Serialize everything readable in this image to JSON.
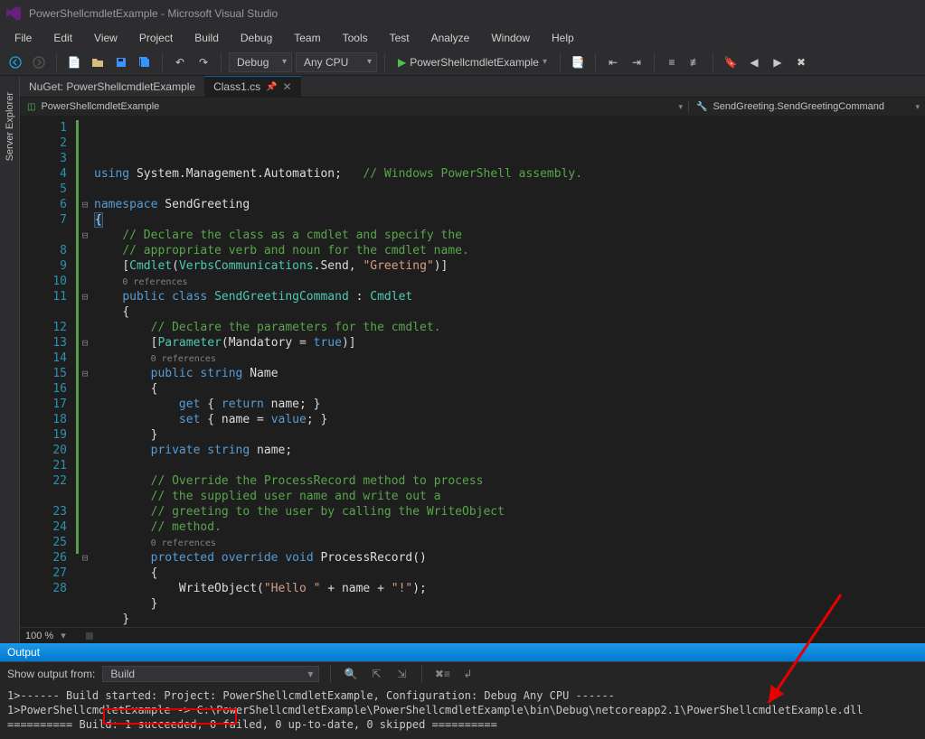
{
  "title": "PowerShellcmdletExample - Microsoft Visual Studio",
  "menu": [
    "File",
    "Edit",
    "View",
    "Project",
    "Build",
    "Debug",
    "Team",
    "Tools",
    "Test",
    "Analyze",
    "Window",
    "Help"
  ],
  "toolbar": {
    "config": "Debug",
    "platform": "Any CPU",
    "start_target": "PowerShellcmdletExample"
  },
  "side_tool": "Server Explorer",
  "tabs": [
    {
      "label": "NuGet: PowerShellcmdletExample",
      "active": false
    },
    {
      "label": "Class1.cs",
      "active": true,
      "pinned": true
    }
  ],
  "nav_left": "PowerShellcmdletExample",
  "nav_right": "SendGreeting.SendGreetingCommand",
  "zoom": "100 %",
  "code_lines": [
    {
      "n": 1,
      "html": "<span class='kw'>using</span> <span class='pl'>System.Management.Automation;</span>   <span class='cm'>// Windows PowerShell assembly.</span>"
    },
    {
      "n": 2,
      "html": ""
    },
    {
      "n": 3,
      "fold": "minus",
      "html": "<span class='kw'>namespace</span> <span class='pl'>SendGreeting</span>"
    },
    {
      "n": 4,
      "html": "<span class='brace-hi pl'>{</span>"
    },
    {
      "n": 5,
      "fold": "minus",
      "html": "    <span class='cm'>// Declare the class as a cmdlet and specify the</span>"
    },
    {
      "n": 6,
      "html": "    <span class='cm'>// appropriate verb and noun for the cmdlet name.</span>"
    },
    {
      "n": 7,
      "html": "    <span class='pl'>[</span><span class='ty'>Cmdlet</span><span class='pl'>(</span><span class='ty'>VerbsCommunications</span><span class='pl'>.Send, </span><span class='str'>\"Greeting\"</span><span class='pl'>)]</span>"
    },
    {
      "n": null,
      "html": "    <span class='ref'>0 references</span>"
    },
    {
      "n": 8,
      "fold": "minus",
      "html": "    <span class='kw'>public class</span> <span class='ty'>SendGreetingCommand</span> <span class='pl'>:</span> <span class='ty'>Cmdlet</span>"
    },
    {
      "n": 9,
      "html": "    <span class='pl'>{</span>"
    },
    {
      "n": 10,
      "html": "        <span class='cm'>// Declare the parameters for the cmdlet.</span>"
    },
    {
      "n": 11,
      "fold": "minus",
      "html": "        <span class='pl'>[</span><span class='ty'>Parameter</span><span class='pl'>(Mandatory = </span><span class='kw'>true</span><span class='pl'>)]</span>"
    },
    {
      "n": null,
      "html": "        <span class='ref'>0 references</span>"
    },
    {
      "n": 12,
      "fold": "minus",
      "html": "        <span class='kw'>public</span> <span class='kw'>string</span> <span class='pl'>Name</span>"
    },
    {
      "n": 13,
      "html": "        <span class='pl'>{</span>"
    },
    {
      "n": 14,
      "html": "            <span class='kw'>get</span> <span class='pl'>{ </span><span class='kw'>return</span><span class='pl'> name; }</span>"
    },
    {
      "n": 15,
      "html": "            <span class='kw'>set</span> <span class='pl'>{ name = </span><span class='kw'>value</span><span class='pl'>; }</span>"
    },
    {
      "n": 16,
      "html": "        <span class='pl'>}</span>"
    },
    {
      "n": 17,
      "html": "        <span class='kw'>private</span> <span class='kw'>string</span> <span class='pl'>name;</span>"
    },
    {
      "n": 18,
      "html": ""
    },
    {
      "n": 19,
      "html": "        <span class='cm'>// Override the ProcessRecord method to process</span>"
    },
    {
      "n": 20,
      "html": "        <span class='cm'>// the supplied user name and write out a</span>"
    },
    {
      "n": 21,
      "html": "        <span class='cm'>// greeting to the user by calling the WriteObject</span>"
    },
    {
      "n": 22,
      "html": "        <span class='cm'>// method.</span>"
    },
    {
      "n": null,
      "html": "        <span class='ref'>0 references</span>"
    },
    {
      "n": 23,
      "fold": "minus",
      "html": "        <span class='kw'>protected override</span> <span class='kw'>void</span> <span class='pl'>ProcessRecord()</span>"
    },
    {
      "n": 24,
      "html": "        <span class='pl'>{</span>"
    },
    {
      "n": 25,
      "html": "            <span class='pl'>WriteObject(</span><span class='str'>\"Hello \"</span><span class='pl'> + name + </span><span class='str'>\"!\"</span><span class='pl'>);</span>"
    },
    {
      "n": 26,
      "html": "        <span class='pl'>}</span>"
    },
    {
      "n": 27,
      "html": "    <span class='pl'>}</span>"
    },
    {
      "n": 28,
      "html": "<span class='brace-hi pl'>}</span>"
    }
  ],
  "output": {
    "title": "Output",
    "show_from_label": "Show output from:",
    "source": "Build",
    "lines": [
      "1>------ Build started: Project: PowerShellcmdletExample, Configuration: Debug Any CPU ------",
      "1>PowerShellcmdletExample -> C:\\PowerShellcmdletExample\\PowerShellcmdletExample\\bin\\Debug\\netcoreapp2.1\\PowerShellcmdletExample.dll",
      "========== Build: 1 succeeded, 0 failed, 0 up-to-date, 0 skipped =========="
    ]
  }
}
